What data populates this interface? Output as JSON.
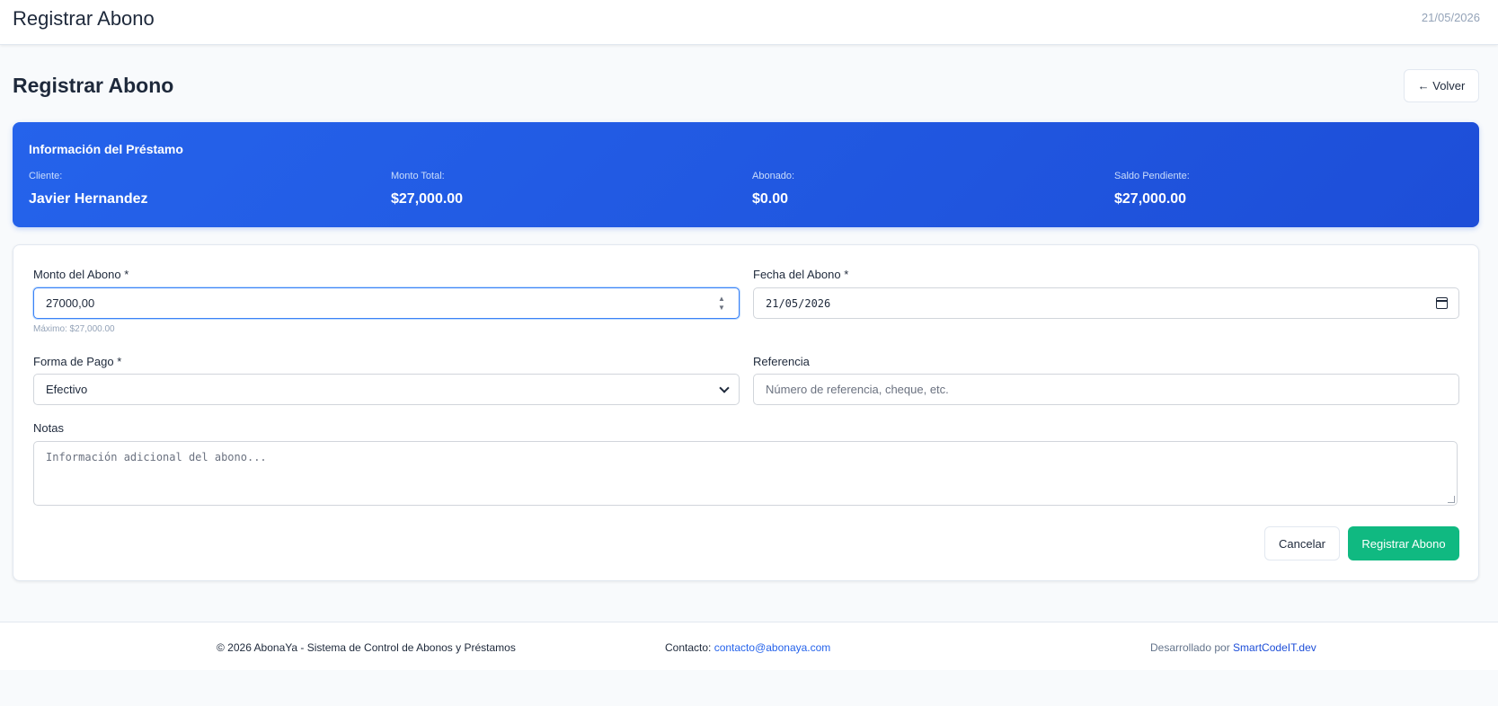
{
  "header": {
    "title": "Registrar Abono",
    "date": "21/05/2026"
  },
  "page": {
    "title": "Registrar Abono",
    "back_label": "← Volver"
  },
  "loan": {
    "title": "Información del Préstamo",
    "client_label": "Cliente:",
    "client_value": "Javier Hernandez",
    "total_label": "Monto Total:",
    "total_value": "$27,000.00",
    "paid_label": "Abonado:",
    "paid_value": "$0.00",
    "balance_label": "Saldo Pendiente:",
    "balance_value": "$27,000.00"
  },
  "form": {
    "amount_label": "Monto del Abono *",
    "amount_value": "27000,00",
    "amount_hint": "Máximo: $27,000.00",
    "date_label": "Fecha del Abono *",
    "date_value": "21/05/2026",
    "payment_method_label": "Forma de Pago *",
    "payment_method_value": "Efectivo",
    "reference_label": "Referencia",
    "reference_placeholder": "Número de referencia, cheque, etc.",
    "notes_label": "Notas",
    "notes_placeholder": "Información adicional del abono...",
    "cancel_label": "Cancelar",
    "submit_label": "Registrar Abono"
  },
  "footer": {
    "copyright": "© 2026 AbonaYa - Sistema de Control de Abonos y Préstamos",
    "contact_label": "Contacto: ",
    "contact_email": "contacto@abonaya.com",
    "developed_label": "Desarrollado por ",
    "developer": "SmartCodeIT.dev"
  },
  "colors": {
    "primary": "#2563eb",
    "success": "#10b981",
    "background": "#f8fafc"
  }
}
